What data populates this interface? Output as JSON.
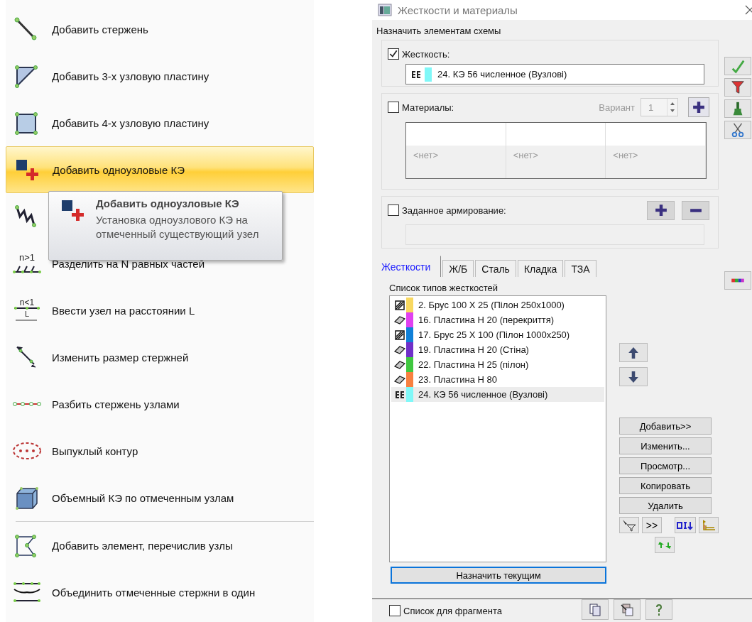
{
  "menu": {
    "items": [
      {
        "kind": "bar",
        "label": "Добавить стержень",
        "highlighted": false
      },
      {
        "kind": "triangle",
        "label": "Добавить 3-х узловую пластину",
        "highlighted": false
      },
      {
        "kind": "quad",
        "label": "Добавить 4-х узловую пластину",
        "highlighted": false
      },
      {
        "kind": "node",
        "label": "Добавить одноузловые КЭ",
        "highlighted": true
      },
      {
        "kind": "spring",
        "highlighted": false
      },
      {
        "kind": "divide",
        "icon_text": [
          "n>1"
        ],
        "label": "Разделить на N равных частей",
        "highlighted": false
      },
      {
        "kind": "distance",
        "icon_text": [
          "n<1",
          "L"
        ],
        "label": "Ввести узел на расстоянии L",
        "highlighted": false
      },
      {
        "kind": "resize",
        "label": "Изменить размер стержней",
        "highlighted": false
      },
      {
        "kind": "split",
        "label": "Разбить стержень узлами",
        "highlighted": false
      },
      {
        "kind": "contour",
        "label": "Выпуклый контур",
        "highlighted": false
      },
      {
        "kind": "solid",
        "label": "Объемный КЭ по отмеченным узлам",
        "highlighted": false
      },
      {
        "kind": "polygon",
        "label": "Добавить элемент, перечислив узлы",
        "highlighted": false,
        "separator_before": true
      },
      {
        "kind": "merge",
        "label": "Объединить отмеченные стержни в один",
        "highlighted": false
      }
    ],
    "tooltip": {
      "title": "Добавить одноузловые КЭ",
      "text": "Установка одноузлового КЭ на отмеченный существующий узел"
    }
  },
  "dialog": {
    "title": "Жесткости и материалы",
    "section_label": "Назначить элементам схемы",
    "stiffness": {
      "checked": true,
      "label": "Жесткость:",
      "value": {
        "kind": "node",
        "color": "#80f8f8",
        "text": "24. КЭ 56 численное (Вузлові)"
      }
    },
    "materials": {
      "checked": false,
      "label": "Материалы:",
      "variant_label": "Вариант",
      "variant": "1",
      "cells": [
        "<нет>",
        "<нет>",
        "<нет>"
      ]
    },
    "reinforcement": {
      "checked": false,
      "label": "Заданное армирование:"
    },
    "tabs": [
      {
        "label": "Жесткости",
        "selected": true
      },
      {
        "label": "Ж/Б",
        "selected": false
      },
      {
        "label": "Сталь",
        "selected": false
      },
      {
        "label": "Кладка",
        "selected": false
      },
      {
        "label": "ТЗА",
        "selected": false
      }
    ],
    "list_title": "Список типов жесткостей",
    "list": [
      {
        "kind": "bar",
        "color": "#f8d860",
        "text": "2. Брус 100 X 25 (Пілон 250x1000)",
        "selected": false
      },
      {
        "kind": "plate",
        "color": "#e040f0",
        "text": "16. Пластина  H 20 (перекриття)",
        "selected": false
      },
      {
        "kind": "bar",
        "color": "#1080d8",
        "text": "17. Брус 25 X 100 (Пілон 1000x250)",
        "selected": false
      },
      {
        "kind": "plate",
        "color": "#7030c8",
        "text": "19. Пластина  H 20 (Стіна)",
        "selected": false
      },
      {
        "kind": "plate",
        "color": "#40c840",
        "text": "22. Пластина  H 25 (пілон)",
        "selected": false
      },
      {
        "kind": "plate",
        "color": "#f88040",
        "text": "23. Пластина  H 80",
        "selected": false
      },
      {
        "kind": "node",
        "color": "#80f8f8",
        "text": "24. КЭ 56 численное (Вузлові)",
        "selected": true
      }
    ],
    "buttons": [
      "Добавить>>",
      "Изменить...",
      "Просмотр...",
      "Копировать",
      "Удалить"
    ],
    "more_button": ">>",
    "assign_button": "Назначить текущим",
    "fragment": {
      "checked": false,
      "label": "Список для фрагмента"
    }
  }
}
